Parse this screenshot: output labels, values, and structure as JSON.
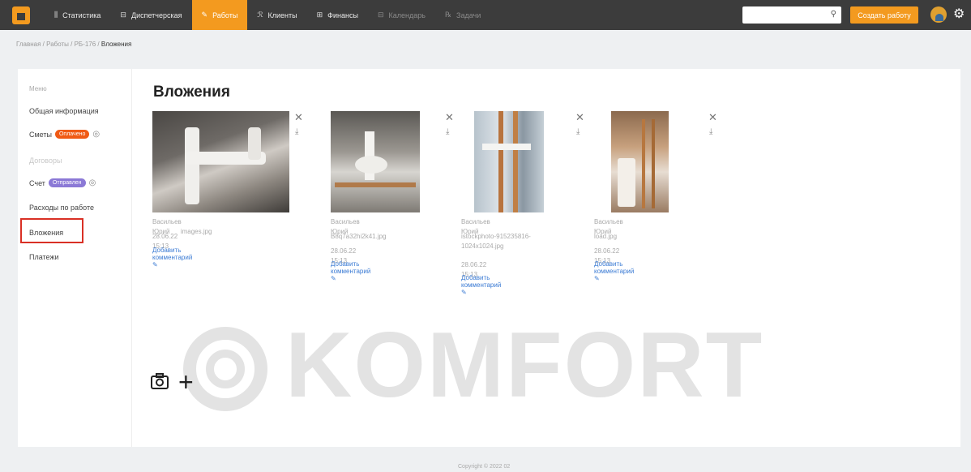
{
  "topbar": {
    "nav": [
      {
        "icon": "chart-icon",
        "glyph": "⫼",
        "label": "Статистика",
        "state": "normal"
      },
      {
        "icon": "dispatch-icon",
        "glyph": "⊟",
        "label": "Диспетчерская",
        "state": "normal"
      },
      {
        "icon": "wrench-icon",
        "glyph": "✎",
        "label": "Работы",
        "state": "active"
      },
      {
        "icon": "clients-icon",
        "glyph": "ℛ",
        "label": "Клиенты",
        "state": "normal"
      },
      {
        "icon": "finance-icon",
        "glyph": "⊞",
        "label": "Финансы",
        "state": "normal"
      },
      {
        "icon": "calendar-icon",
        "glyph": "⊟",
        "label": "Календарь",
        "state": "disabled"
      },
      {
        "icon": "tasks-icon",
        "glyph": "℞",
        "label": "Задачи",
        "state": "disabled"
      }
    ],
    "search": {
      "placeholder": "",
      "value": ""
    },
    "create_button": "Создать работу"
  },
  "breadcrumb": {
    "home": "Главная",
    "works": "Работы",
    "job": "РБ-176",
    "current": "Вложения"
  },
  "sidebar": {
    "title": "Меню",
    "items": [
      {
        "label": "Общая информация"
      },
      {
        "label": "Сметы",
        "badge": "Оплачено"
      },
      {
        "label": "Договоры"
      },
      {
        "label": "Счет",
        "badge": "Отправлен"
      },
      {
        "label": "Расходы по работе"
      },
      {
        "label": "Вложения"
      },
      {
        "label": "Платежи"
      }
    ]
  },
  "main": {
    "title": "Вложения",
    "attachments": [
      {
        "author": "Васильев Юрий",
        "filename": "images.jpg",
        "date": "28.06.22 15:13",
        "comment": "Добавить комментарий"
      },
      {
        "author": "Васильев Юрий",
        "filename": "B8q7a32hi2k41.jpg",
        "date": "28.06.22 15:13",
        "comment": "Добавить комментарий"
      },
      {
        "author": "Васильев Юрий",
        "filename": "istockphoto-915235816-1024x1024.jpg",
        "date": "28.06.22 15:13",
        "comment": "Добавить комментарий"
      },
      {
        "author": "Васильев Юрий",
        "filename": "load.jpg",
        "date": "28.06.22 15:13",
        "comment": "Добавить комментарий"
      }
    ],
    "watermark": "KOMFORT"
  },
  "footer": {
    "copyright": "Copyright © 2022 02"
  },
  "colors": {
    "accent": "#f39a1f",
    "topbar": "#3c3c3c",
    "link": "#3b7bd4",
    "badge_paid": "#f05a14",
    "badge_sent": "#8b79d6"
  }
}
